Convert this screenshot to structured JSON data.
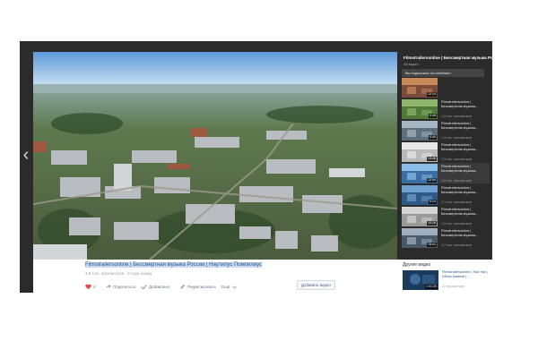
{
  "video": {
    "title_highlight": "Filmstrailersonline | Бессмертная музыка России | Наутилус Помпилиус",
    "meta": "4,6 тыс. просмотров · 3 года назад"
  },
  "actions": {
    "likes": "4",
    "share": "Поделиться",
    "added": "Добавлено",
    "edit": "Редактировать",
    "more": "Ещё",
    "add_to_mine": "Добавить видео"
  },
  "playlist": {
    "title": "Filmstrailersonline | Бессмертная музыка России",
    "count": "35 видео",
    "subscribe_notice": "Вы подписаны на плейлист",
    "items": [
      {
        "title": "",
        "views": "",
        "duration": "12:24"
      },
      {
        "title": "Filmstrailersonline | Бессмертная музыка...",
        "views": "1,2 тыс. просмотров",
        "duration": "4:48"
      },
      {
        "title": "Filmstrailersonline | Бессмертная музыка...",
        "views": "1,4 тыс. просмотров",
        "duration": "4:40"
      },
      {
        "title": "Filmstrailersonline | Бессмертная музыка...",
        "views": "2,3 тыс. просмотров",
        "duration": "14:46"
      },
      {
        "title": "Filmstrailersonline | Бессмертная музыка...",
        "views": "4,6 тыс. просмотров",
        "duration": "12:59"
      },
      {
        "title": "Filmstrailersonline | Бессмертная музыка...",
        "views": "2,1 тыс. просмотров",
        "duration": "5:24"
      },
      {
        "title": "Filmstrailersonline | Бессмертная музыка...",
        "views": "1,5 тыс. просмотров",
        "duration": "10:26"
      },
      {
        "title": "Filmstrailersonline | Бессмертная музыка...",
        "views": "4,7 тыс. просмотров",
        "duration": "15:41"
      }
    ]
  },
  "other_videos": {
    "heading": "Другие видео",
    "item": {
      "title": "Filmstrailersonline | Маг ник | Абхаз Азимов |...",
      "views": "12 просмотров",
      "duration": "1:01:20"
    }
  }
}
